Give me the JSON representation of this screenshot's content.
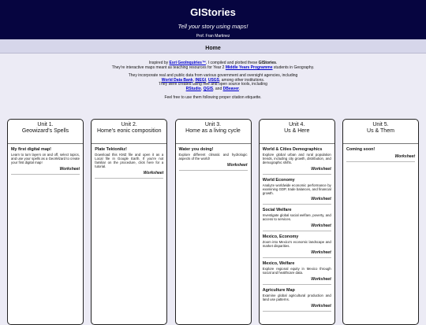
{
  "header": {
    "title": "GIStories",
    "tagline": "Tell your story using maps!",
    "author": "Prof. Fran Martinez"
  },
  "nav": {
    "home": "Home"
  },
  "intro": {
    "l1_a": "Inspired by ",
    "l1_link": "Esri GeoInquiries™",
    "l1_b": ", I compiled and plotted these ",
    "l1_bold": "GIStories",
    "l1_c": ".",
    "l2_a": "They're interactive maps meant as teaching resources for Year 2 ",
    "l2_link": "Middle Years Programme",
    "l2_b": " students in Geography.",
    "l3": "They incorporate real and public data from various government and oversight agencies, including",
    "l4_link1": "World Data Bank",
    "l4_sep1": ", ",
    "l4_link2": "INEGI",
    "l4_sep2": ", ",
    "l4_link3": "USGS",
    "l4_b": ", among other institutions.",
    "l5": "They were created using free and open source tools, including",
    "l6_link1": "RStudio",
    "l6_sep1": ", ",
    "l6_link2": "QGIS",
    "l6_sep2": ", and ",
    "l6_link3": "DBeaver",
    "l6_b": ".",
    "l7": "Feel free to use them following proper citation etiquette."
  },
  "units": [
    {
      "num": "Unit 1.",
      "name": "Geowizard's Spells",
      "items": [
        {
          "title": "My first digital map!",
          "desc": "Learn to turn layers on and off, select topics, and use your spells as a GeoWizard to create your first digital map!",
          "ws": "Worksheet"
        }
      ]
    },
    {
      "num": "Unit 2.",
      "name": "Home's eonic composition",
      "items": [
        {
          "title": "Plate Tektonikz!",
          "desc": "Download this KMZ file and open it as a Local file in Google Earth. If you're not familiar on the procedure, click here for a tutorial.",
          "ws": "Worksheet"
        }
      ]
    },
    {
      "num": "Unit 3.",
      "name": "Home as a living cycle",
      "items": [
        {
          "title": "Water you doing!",
          "desc": "Explore different climatic and hydrologic aspects of the world!",
          "ws": "Worksheet"
        }
      ]
    },
    {
      "num": "Unit 4.",
      "name": "Us & Here",
      "items": [
        {
          "title": "World & Cities Demographics",
          "desc": "Explore global urban and rural population trends, including city growth, distribution, and demographic shifts.",
          "ws": "Worksheet"
        },
        {
          "title": "World Economy",
          "desc": "Analyze worldwide economic performance by examining GDP, trade balances, and financial growth.",
          "ws": "Worksheet"
        },
        {
          "title": "Social Welfare",
          "desc": "Investigate global social welfare, poverty, and access to services.",
          "ws": "Worksheet"
        },
        {
          "title": "Mexico, Economy",
          "desc": "Zoom into Mexico's economic landscape and market disparities.",
          "ws": "Worksheet"
        },
        {
          "title": "Mexico, Welfare",
          "desc": "Explore regional equity in Mexico through social and healthcare data.",
          "ws": "Worksheet"
        },
        {
          "title": "Agriculture Map",
          "desc": "Examine global agricultural production and land use patterns.",
          "ws": "Worksheet"
        }
      ]
    },
    {
      "num": "Unit 5.",
      "name": "Us & Them",
      "items": [
        {
          "title": "Coming soon!",
          "desc": "",
          "ws": "Worksheet"
        }
      ]
    }
  ]
}
